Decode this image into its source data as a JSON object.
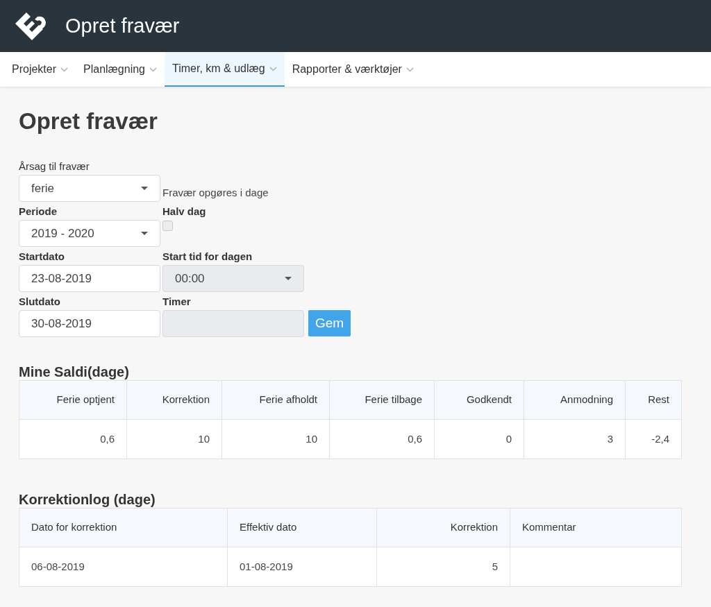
{
  "header": {
    "title": "Opret fravær"
  },
  "nav": [
    {
      "label": "Projekter",
      "selected": false
    },
    {
      "label": "Planlægning",
      "selected": false
    },
    {
      "label": "Timer, km & udlæg",
      "selected": true
    },
    {
      "label": "Rapporter & værktøjer",
      "selected": false
    }
  ],
  "page_title": "Opret fravær",
  "form": {
    "reason": {
      "label": "Årsag til fravær",
      "value": "ferie"
    },
    "unit_note": "Fravær opgøres i dage",
    "period": {
      "label": "Periode",
      "value": "2019 - 2020"
    },
    "half_day": {
      "label": "Halv dag",
      "checked": false
    },
    "start_date": {
      "label": "Startdato",
      "value": "23-08-2019"
    },
    "start_time": {
      "label": "Start tid for dagen",
      "value": "00:00",
      "disabled": true
    },
    "end_date": {
      "label": "Slutdato",
      "value": "30-08-2019"
    },
    "hours": {
      "label": "Timer",
      "disabled": true
    },
    "save_button": "Gem"
  },
  "balances": {
    "title": "Mine Saldi(dage)",
    "columns": [
      {
        "label": "Ferie optjent",
        "kind": "number"
      },
      {
        "label": "Korrektion",
        "kind": "number"
      },
      {
        "label": "Ferie afholdt",
        "kind": "number"
      },
      {
        "label": "Ferie tilbage",
        "kind": "number"
      },
      {
        "label": "Godkendt",
        "kind": "number"
      },
      {
        "label": "Anmodning",
        "kind": "number"
      },
      {
        "label": "Rest",
        "kind": "number"
      }
    ],
    "rows": [
      [
        "0,6",
        "10",
        "10",
        "0,6",
        "0",
        "3",
        "-2,4"
      ]
    ]
  },
  "correction_log": {
    "title": "Korrektionlog (dage)",
    "columns": [
      {
        "label": "Dato for korrektion",
        "kind": "text"
      },
      {
        "label": "Effektiv dato",
        "kind": "text"
      },
      {
        "label": "Korrektion",
        "kind": "number"
      },
      {
        "label": "Kommentar",
        "kind": "text"
      }
    ],
    "rows": [
      [
        "06-08-2019",
        "01-08-2019",
        "5",
        ""
      ]
    ]
  }
}
